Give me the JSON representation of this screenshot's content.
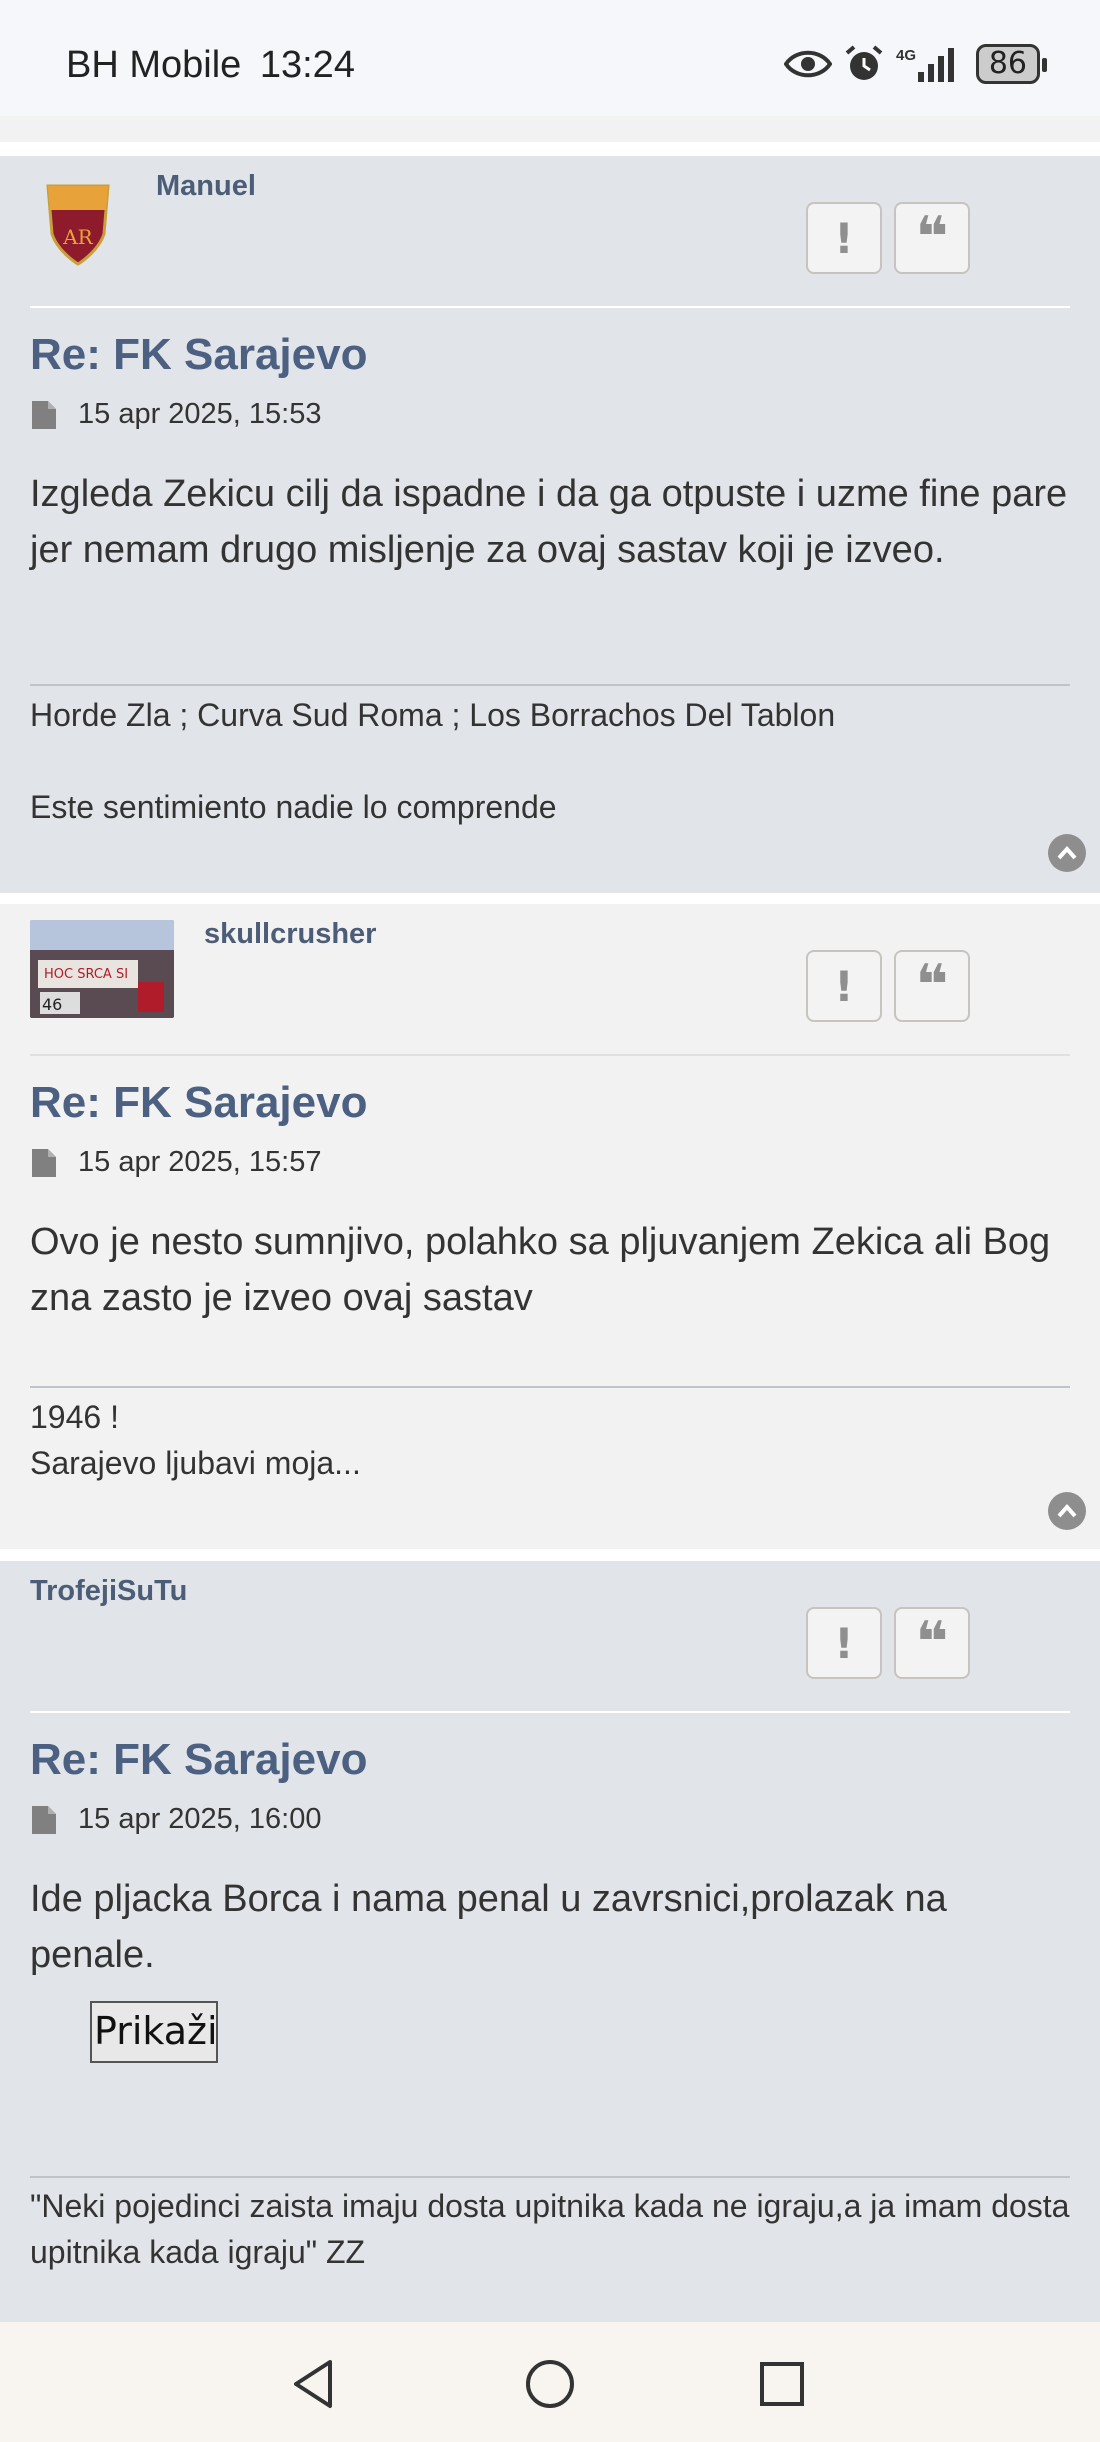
{
  "status_bar": {
    "carrier": "BH Mobile",
    "time": "13:24",
    "network": "4G",
    "battery": "86"
  },
  "posts": [
    {
      "username": "Manuel",
      "title": "Re: FK Sarajevo",
      "date": "15 apr 2025, 15:53",
      "body": "Izgleda Zekicu cilj da ispadne i da ga otpuste i uzme fine pare jer nemam drugo misljenje za ovaj sastav koji je izveo.",
      "signature": [
        "Horde Zla ; Curva Sud Roma ; Los Borrachos Del Tablon",
        "",
        "Este sentimiento nadie lo comprende"
      ]
    },
    {
      "username": "skullcrusher",
      "title": "Re: FK Sarajevo",
      "date": "15 apr 2025, 15:57",
      "body": "Ovo je nesto sumnjivo, polahko sa pljuvanjem Zekica ali Bog zna zasto je izveo ovaj sastav",
      "signature": [
        "1946 !",
        "Sarajevo ljubavi moja..."
      ]
    },
    {
      "username": "TrofejiSuTu",
      "title": "Re: FK Sarajevo",
      "date": "15 apr 2025, 16:00",
      "body": "Ide pljacka Borca i nama penal u zavrsnici,prolazak na penale.",
      "spoiler_button": "Prikaži",
      "signature": [
        "\"Neki pojedinci zaista imaju dosta upitnika kada ne igraju,a ja imam dosta upitnika kada igraju\" ZZ"
      ]
    }
  ],
  "buttons": {
    "report": "!",
    "quote": "❝"
  },
  "colors": {
    "post_bg_dark": "#e1e4e8",
    "post_bg_light": "#f2f2f2",
    "title": "#4c6082",
    "username": "#4c5d77"
  }
}
